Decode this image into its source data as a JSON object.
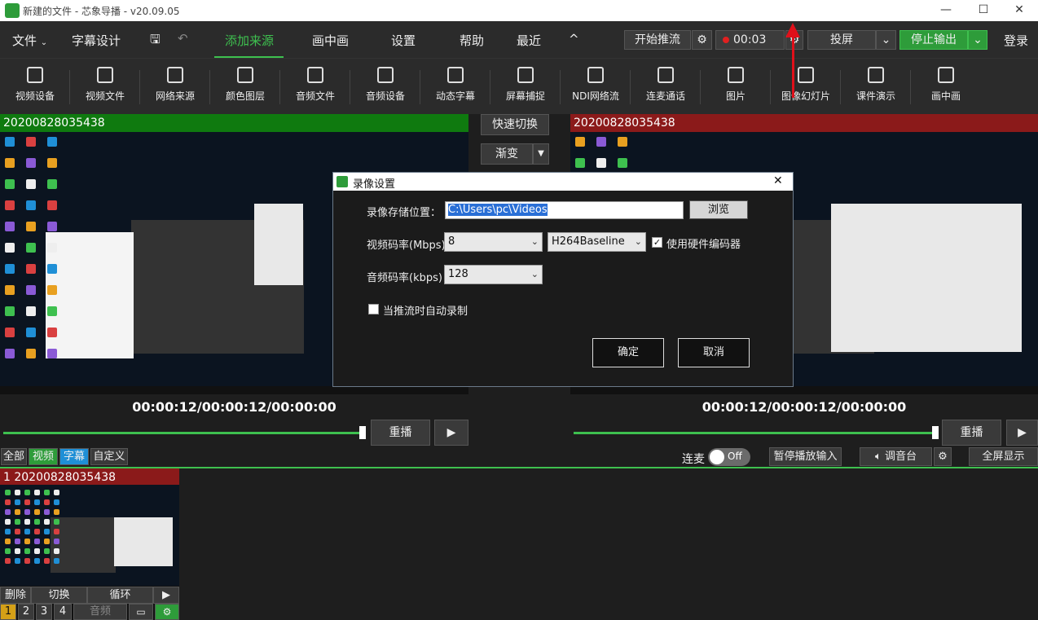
{
  "window": {
    "title": "新建的文件 - 芯象导播 - v20.09.05",
    "minimize": "—",
    "maximize": "☐",
    "close": "✕"
  },
  "menubar": {
    "file": "文件",
    "caption_design": "字幕设计",
    "add_source": "添加来源",
    "pip": "画中画",
    "settings": "设置",
    "help": "帮助",
    "recent": "最近",
    "collapse": "^",
    "start_stream": "开始推流",
    "record_time": "00:03",
    "cast": "投屏",
    "stop_output": "停止输出",
    "login": "登录"
  },
  "toolbar": [
    {
      "label": "视频设备",
      "icon": "video-device-icon"
    },
    {
      "label": "视频文件",
      "icon": "video-file-icon"
    },
    {
      "label": "网络来源",
      "icon": "network-source-icon"
    },
    {
      "label": "颜色图层",
      "icon": "color-layer-icon"
    },
    {
      "label": "音频文件",
      "icon": "audio-file-icon"
    },
    {
      "label": "音频设备",
      "icon": "microphone-icon"
    },
    {
      "label": "动态字幕",
      "icon": "dynamic-caption-icon"
    },
    {
      "label": "屏幕捕捉",
      "icon": "screen-capture-icon"
    },
    {
      "label": "NDI网络流",
      "icon": "ndi-icon"
    },
    {
      "label": "连麦通话",
      "icon": "call-icon"
    },
    {
      "label": "图片",
      "icon": "image-icon"
    },
    {
      "label": "图像幻灯片",
      "icon": "slideshow-icon"
    },
    {
      "label": "课件演示",
      "icon": "courseware-icon"
    },
    {
      "label": "画中画",
      "icon": "pip-icon"
    }
  ],
  "preview": {
    "title": "20200828035438",
    "timecode": "00:00:12/00:00:12/00:00:00",
    "replay": "重播",
    "play": "▶"
  },
  "program": {
    "title": "20200828035438",
    "timecode": "00:00:12/00:00:12/00:00:00",
    "replay": "重播",
    "play": "▶"
  },
  "transition": {
    "quick_switch": "快速切换",
    "fade": "渐变"
  },
  "filters": {
    "all": "全部",
    "video": "视频",
    "caption": "字幕",
    "custom": "自定义"
  },
  "controls": {
    "lianmai": "连麦",
    "toggle": "Off",
    "pause_input": "暂停播放输入",
    "mixer": "调音台",
    "fullscreen": "全屏显示"
  },
  "source_item": {
    "title": "1 20200828035438",
    "delete": "删除",
    "switch": "切换",
    "loop": "循环",
    "play": "▶",
    "pages": [
      "1",
      "2",
      "3",
      "4"
    ],
    "audio": "音频"
  },
  "dialog": {
    "title": "录像设置",
    "close": "✕",
    "path_label": "录像存储位置：",
    "path_value": "C:\\Users\\pc\\Videos",
    "browse": "浏览",
    "video_bitrate_label": "视频码率(Mbps)",
    "video_bitrate_value": "8",
    "codec_value": "H264Baseline",
    "hw_encoder_label": "使用硬件编码器",
    "hw_encoder_checked": true,
    "audio_bitrate_label": "音频码率(kbps)：",
    "audio_bitrate_value": "128",
    "auto_record_label": "当推流时自动录制",
    "auto_record_checked": false,
    "ok": "确定",
    "cancel": "取消"
  },
  "colors": {
    "accent_green": "#3ec04f",
    "preview_header": "#0f7a0f",
    "program_header": "#8b1a1a",
    "record_dot": "#e02020",
    "annotation_arrow": "#e0101a"
  }
}
